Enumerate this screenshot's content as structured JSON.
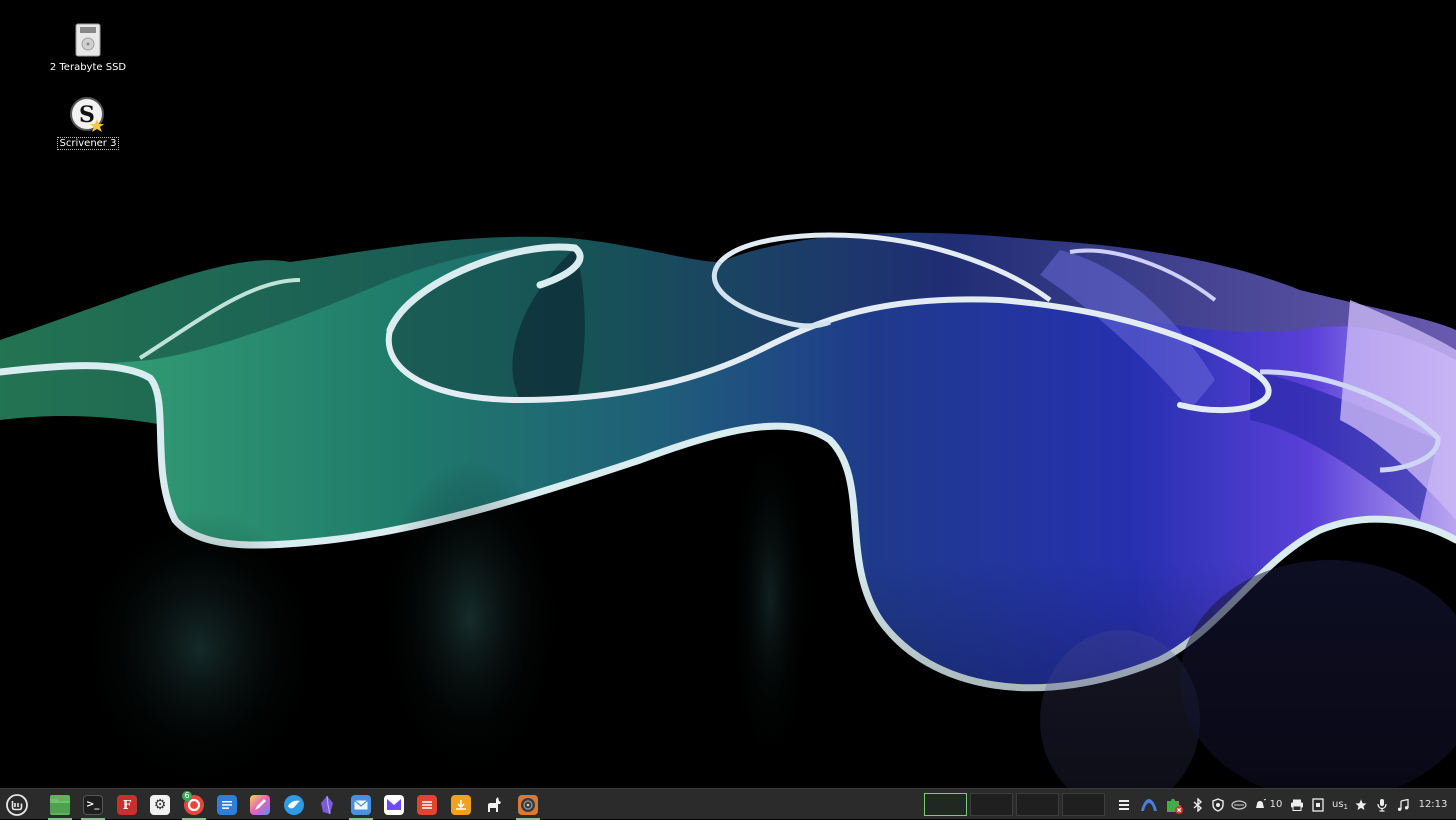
{
  "desktop": {
    "icons": [
      {
        "label": "2 Terabyte SSD",
        "icon": "drive-icon"
      },
      {
        "label": "Scrivener 3",
        "icon": "scrivener-icon"
      }
    ]
  },
  "taskbar": {
    "menu_icon": "mint-menu-icon",
    "apps": [
      {
        "icon": "files-icon",
        "running": true
      },
      {
        "icon": "terminal-icon",
        "running": true
      },
      {
        "icon": "font-manager-icon",
        "running": false
      },
      {
        "icon": "settings-icon",
        "running": false
      },
      {
        "icon": "vivaldi-icon",
        "running": true,
        "badge": "6"
      },
      {
        "icon": "text-editor-icon",
        "running": false
      },
      {
        "icon": "drawing-icon",
        "running": false
      },
      {
        "icon": "bird-icon",
        "running": false
      },
      {
        "icon": "obsidian-icon",
        "running": false
      },
      {
        "icon": "mail-icon",
        "running": true
      },
      {
        "icon": "proton-mail-icon",
        "running": false
      },
      {
        "icon": "todoist-icon",
        "running": false
      },
      {
        "icon": "installer-icon",
        "running": false
      },
      {
        "icon": "llama-icon",
        "running": false
      },
      {
        "icon": "disk-icon",
        "running": true
      }
    ],
    "workspaces": [
      {
        "active": true
      },
      {
        "active": false
      },
      {
        "active": false
      },
      {
        "active": false
      }
    ],
    "tray": {
      "notification_count": "10",
      "keyboard_layout": "us",
      "clock": "12:13"
    }
  },
  "colors": {
    "taskbar_bg": "#2b2b2b",
    "accent": "#7ec97e"
  }
}
